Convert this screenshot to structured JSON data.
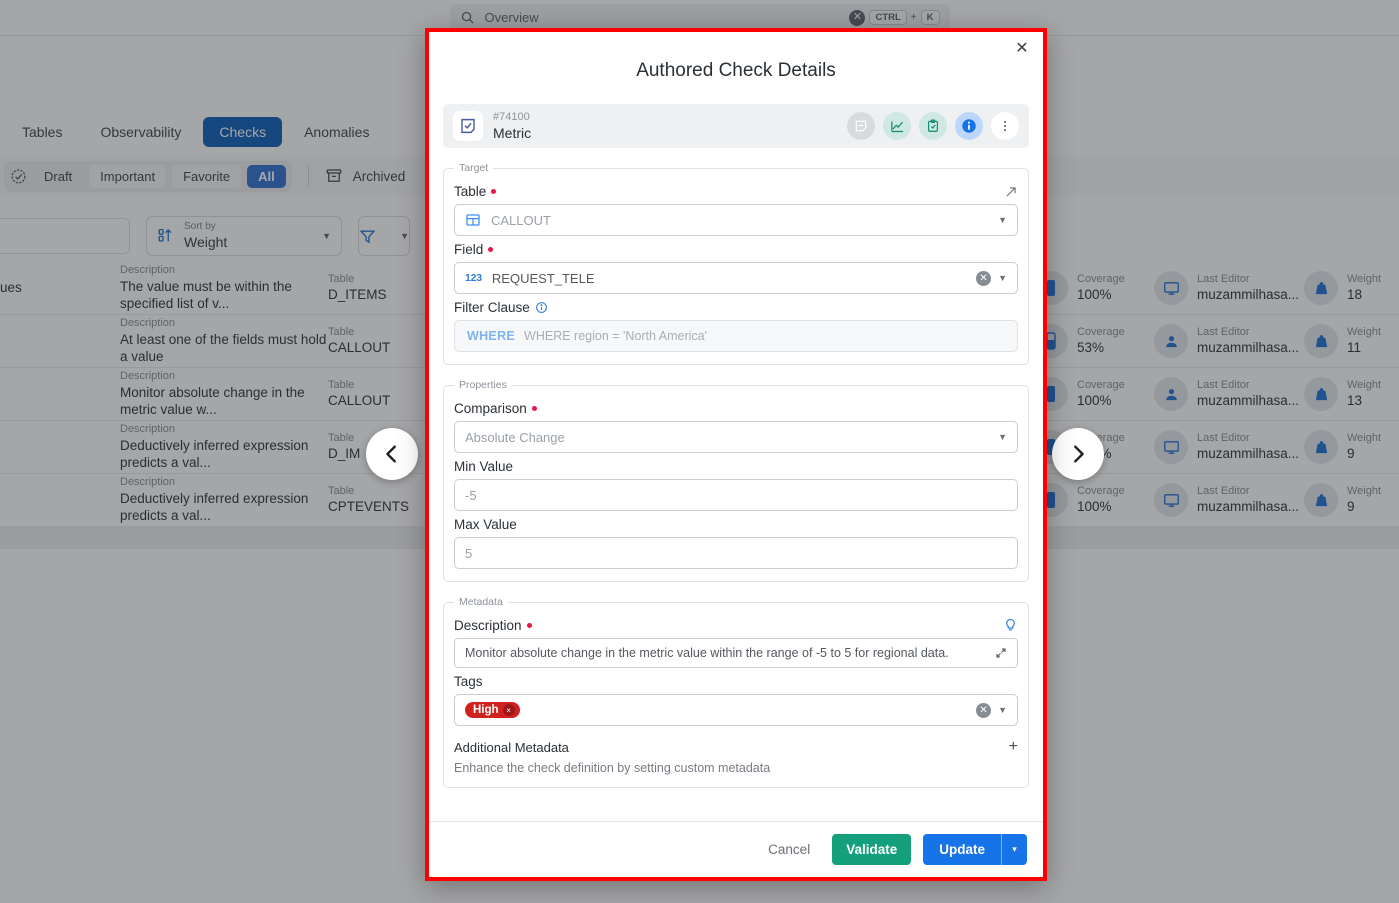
{
  "topbar": {
    "search_value": "Overview",
    "shortcut_ctrl": "CTRL",
    "shortcut_plus": "+",
    "shortcut_key": "K"
  },
  "tabs": [
    {
      "label": "Tables",
      "active": false
    },
    {
      "label": "Observability",
      "active": false
    },
    {
      "label": "Checks",
      "active": true
    },
    {
      "label": "Anomalies",
      "active": false
    }
  ],
  "filters": {
    "segments": [
      {
        "label": "Draft",
        "style": "plain"
      },
      {
        "label": "Important",
        "style": "box"
      },
      {
        "label": "Favorite",
        "style": "box"
      },
      {
        "label": "All",
        "style": "selected"
      }
    ],
    "archived_label": "Archived"
  },
  "controls": {
    "sort_label": "Sort by",
    "sort_value": "Weight"
  },
  "table": {
    "headers": {
      "description": "Description",
      "table": "Table",
      "coverage": "Coverage",
      "last_editor": "Last Editor",
      "weight": "Weight"
    },
    "rows": [
      {
        "trunc": "ues",
        "description": "The value must be within the specified list of v...",
        "table": "D_ITEMS",
        "coverage": "100%",
        "coverage_level": "full",
        "editor": "muzammilhasa...",
        "editor_icon": "monitor-icon",
        "weight": "18"
      },
      {
        "trunc": "",
        "description": "At least one of the fields must hold a value",
        "table": "CALLOUT",
        "coverage": "53%",
        "coverage_level": "partial",
        "editor": "muzammilhasa...",
        "editor_icon": "person-icon",
        "weight": "11"
      },
      {
        "trunc": "",
        "description": "Monitor absolute change in the metric value w...",
        "table": "CALLOUT",
        "coverage": "100%",
        "coverage_level": "full",
        "editor": "muzammilhasa...",
        "editor_icon": "person-icon",
        "weight": "13"
      },
      {
        "trunc": "",
        "description": "Deductively inferred expression predicts a val...",
        "table": "D_IM",
        "coverage": "100%",
        "coverage_level": "full",
        "editor": "muzammilhasa...",
        "editor_icon": "monitor-icon",
        "weight": "9"
      },
      {
        "trunc": "",
        "description": "Deductively inferred expression predicts a val...",
        "table": "CPTEVENTS",
        "coverage": "100%",
        "coverage_level": "full",
        "editor": "muzammilhasa...",
        "editor_icon": "monitor-icon",
        "weight": "9"
      }
    ]
  },
  "modal": {
    "title": "Authored Check Details",
    "close_label": "✕",
    "check": {
      "id": "#74100",
      "type": "Metric"
    },
    "target": {
      "legend": "Target",
      "table_label": "Table",
      "table_value": "CALLOUT",
      "field_label": "Field",
      "field_value": "REQUEST_TELE",
      "field_type_badge": "123",
      "filter_label": "Filter Clause",
      "filter_keyword": "WHERE",
      "filter_placeholder": "WHERE region = 'North America'"
    },
    "properties": {
      "legend": "Properties",
      "comparison_label": "Comparison",
      "comparison_value": "Absolute Change",
      "min_label": "Min Value",
      "min_value": "-5",
      "max_label": "Max Value",
      "max_value": "5"
    },
    "metadata": {
      "legend": "Metadata",
      "description_label": "Description",
      "description_value": "Monitor absolute change in the metric value within the range of -5 to 5 for regional data.",
      "tags_label": "Tags",
      "tags": [
        {
          "label": "High",
          "color": "#d02020",
          "remove": "×"
        }
      ],
      "additional_label": "Additional Metadata",
      "additional_plus": "+",
      "additional_sub": "Enhance the check definition by setting custom metadata"
    },
    "footer": {
      "cancel": "Cancel",
      "validate": "Validate",
      "update": "Update",
      "update_caret": "▾"
    }
  },
  "nav": {
    "prev": "‹",
    "next": "›"
  },
  "colors": {
    "accent_blue": "#1673e8",
    "tab_active": "#0b5cb8",
    "validate_green": "#14a07c",
    "tag_red": "#d02020",
    "required_dot": "#e8174b",
    "outline_red": "#ff0000"
  }
}
